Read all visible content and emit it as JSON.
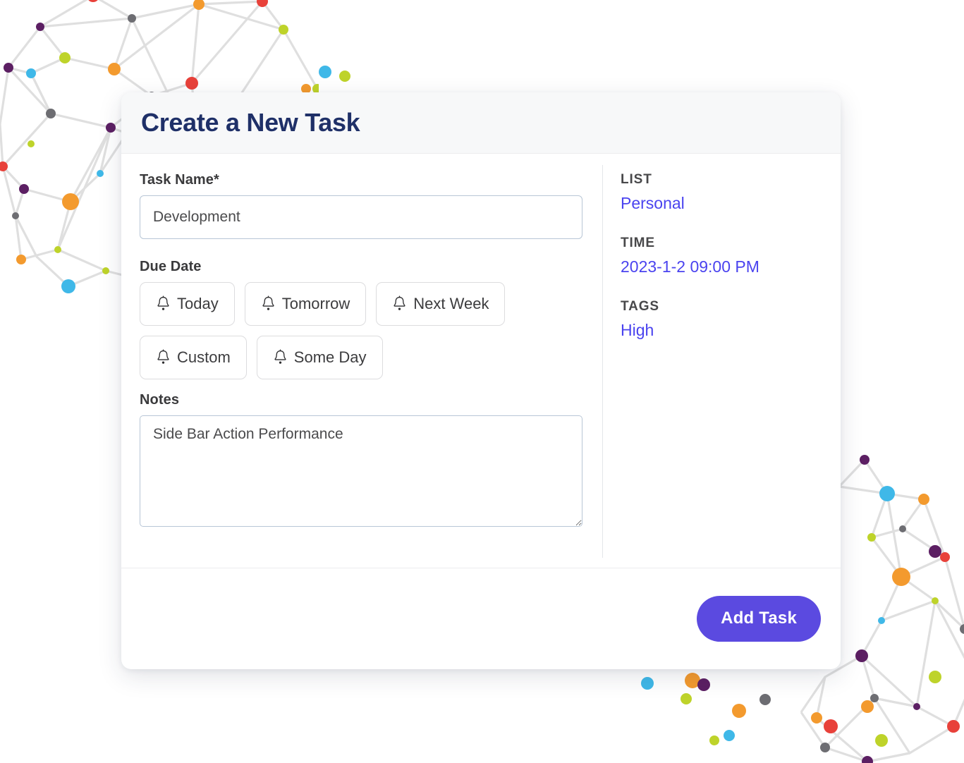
{
  "card": {
    "title": "Create a New Task"
  },
  "form": {
    "task_name": {
      "label": "Task Name*",
      "value": "Development",
      "placeholder": "Task Name"
    },
    "due_date": {
      "label": "Due Date",
      "options": [
        {
          "label": "Today",
          "icon": "bell-icon"
        },
        {
          "label": "Tomorrow",
          "icon": "bell-icon"
        },
        {
          "label": "Next Week",
          "icon": "bell-icon"
        },
        {
          "label": "Custom",
          "icon": "bell-icon"
        },
        {
          "label": "Some Day",
          "icon": "bell-icon"
        }
      ]
    },
    "notes": {
      "label": "Notes",
      "value": "Side Bar Action Performance",
      "placeholder": "Notes"
    }
  },
  "sidebar": {
    "list": {
      "key": "LIST",
      "value": "Personal"
    },
    "time": {
      "key": "TIME",
      "value": "2023-1-2 09:00 PM"
    },
    "tags": {
      "key": "TAGS",
      "value": "High"
    }
  },
  "footer": {
    "add_task_label": "Add Task"
  },
  "colors": {
    "title_navy": "#1f3068",
    "link_blue": "#4a43ef",
    "accent_purple": "#5b4ae0",
    "header_bg": "#f7f8f9",
    "input_border": "#b8c6d6",
    "chip_border": "#dcdcde"
  },
  "decoration": {
    "name": "network-mesh-graphic",
    "node_colors": [
      "#e8413a",
      "#f39a2e",
      "#2eaee0",
      "#5c1f63",
      "#bed32a",
      "#6d6d72",
      "#3fb8e8"
    ]
  }
}
